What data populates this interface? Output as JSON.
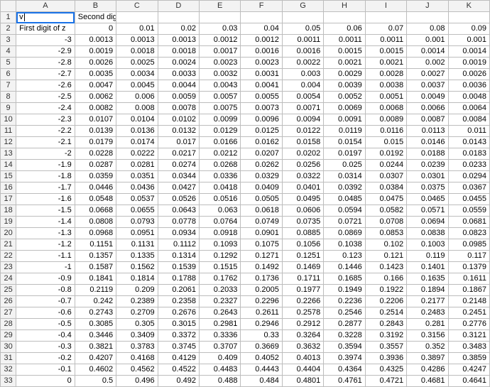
{
  "columns": [
    "A",
    "B",
    "C",
    "D",
    "E",
    "F",
    "G",
    "H",
    "I",
    "J",
    "K"
  ],
  "activeCell": "A1",
  "rows": [
    {
      "r": 1,
      "cells": [
        "v",
        "Second digit of z",
        "",
        "",
        "",
        "",
        "",
        "",
        "",
        "",
        ""
      ],
      "align": [
        "txt",
        "txt",
        "txt",
        "txt",
        "txt",
        "txt",
        "txt",
        "txt",
        "txt",
        "txt",
        "txt"
      ]
    },
    {
      "r": 2,
      "cells": [
        "First digit of z",
        "0",
        "0.01",
        "0.02",
        "0.03",
        "0.04",
        "0.05",
        "0.06",
        "0.07",
        "0.08",
        "0.09"
      ],
      "align": [
        "txt",
        "num",
        "num",
        "num",
        "num",
        "num",
        "num",
        "num",
        "num",
        "num",
        "num"
      ]
    },
    {
      "r": 3,
      "cells": [
        "-3",
        "0.0013",
        "0.0013",
        "0.0013",
        "0.0012",
        "0.0012",
        "0.0011",
        "0.0011",
        "0.0011",
        "0.001",
        "0.001"
      ],
      "align": [
        "num",
        "num",
        "num",
        "num",
        "num",
        "num",
        "num",
        "num",
        "num",
        "num",
        "num"
      ]
    },
    {
      "r": 4,
      "cells": [
        "-2.9",
        "0.0019",
        "0.0018",
        "0.0018",
        "0.0017",
        "0.0016",
        "0.0016",
        "0.0015",
        "0.0015",
        "0.0014",
        "0.0014"
      ],
      "align": [
        "num",
        "num",
        "num",
        "num",
        "num",
        "num",
        "num",
        "num",
        "num",
        "num",
        "num"
      ]
    },
    {
      "r": 5,
      "cells": [
        "-2.8",
        "0.0026",
        "0.0025",
        "0.0024",
        "0.0023",
        "0.0023",
        "0.0022",
        "0.0021",
        "0.0021",
        "0.002",
        "0.0019"
      ],
      "align": [
        "num",
        "num",
        "num",
        "num",
        "num",
        "num",
        "num",
        "num",
        "num",
        "num",
        "num"
      ]
    },
    {
      "r": 6,
      "cells": [
        "-2.7",
        "0.0035",
        "0.0034",
        "0.0033",
        "0.0032",
        "0.0031",
        "0.003",
        "0.0029",
        "0.0028",
        "0.0027",
        "0.0026"
      ],
      "align": [
        "num",
        "num",
        "num",
        "num",
        "num",
        "num",
        "num",
        "num",
        "num",
        "num",
        "num"
      ]
    },
    {
      "r": 7,
      "cells": [
        "-2.6",
        "0.0047",
        "0.0045",
        "0.0044",
        "0.0043",
        "0.0041",
        "0.004",
        "0.0039",
        "0.0038",
        "0.0037",
        "0.0036"
      ],
      "align": [
        "num",
        "num",
        "num",
        "num",
        "num",
        "num",
        "num",
        "num",
        "num",
        "num",
        "num"
      ]
    },
    {
      "r": 8,
      "cells": [
        "-2.5",
        "0.0062",
        "0.006",
        "0.0059",
        "0.0057",
        "0.0055",
        "0.0054",
        "0.0052",
        "0.0051",
        "0.0049",
        "0.0048"
      ],
      "align": [
        "num",
        "num",
        "num",
        "num",
        "num",
        "num",
        "num",
        "num",
        "num",
        "num",
        "num"
      ]
    },
    {
      "r": 9,
      "cells": [
        "-2.4",
        "0.0082",
        "0.008",
        "0.0078",
        "0.0075",
        "0.0073",
        "0.0071",
        "0.0069",
        "0.0068",
        "0.0066",
        "0.0064"
      ],
      "align": [
        "num",
        "num",
        "num",
        "num",
        "num",
        "num",
        "num",
        "num",
        "num",
        "num",
        "num"
      ]
    },
    {
      "r": 10,
      "cells": [
        "-2.3",
        "0.0107",
        "0.0104",
        "0.0102",
        "0.0099",
        "0.0096",
        "0.0094",
        "0.0091",
        "0.0089",
        "0.0087",
        "0.0084"
      ],
      "align": [
        "num",
        "num",
        "num",
        "num",
        "num",
        "num",
        "num",
        "num",
        "num",
        "num",
        "num"
      ]
    },
    {
      "r": 11,
      "cells": [
        "-2.2",
        "0.0139",
        "0.0136",
        "0.0132",
        "0.0129",
        "0.0125",
        "0.0122",
        "0.0119",
        "0.0116",
        "0.0113",
        "0.011"
      ],
      "align": [
        "num",
        "num",
        "num",
        "num",
        "num",
        "num",
        "num",
        "num",
        "num",
        "num",
        "num"
      ]
    },
    {
      "r": 12,
      "cells": [
        "-2.1",
        "0.0179",
        "0.0174",
        "0.017",
        "0.0166",
        "0.0162",
        "0.0158",
        "0.0154",
        "0.015",
        "0.0146",
        "0.0143"
      ],
      "align": [
        "num",
        "num",
        "num",
        "num",
        "num",
        "num",
        "num",
        "num",
        "num",
        "num",
        "num"
      ]
    },
    {
      "r": 13,
      "cells": [
        "-2",
        "0.0228",
        "0.0222",
        "0.0217",
        "0.0212",
        "0.0207",
        "0.0202",
        "0.0197",
        "0.0192",
        "0.0188",
        "0.0183"
      ],
      "align": [
        "num",
        "num",
        "num",
        "num",
        "num",
        "num",
        "num",
        "num",
        "num",
        "num",
        "num"
      ]
    },
    {
      "r": 14,
      "cells": [
        "-1.9",
        "0.0287",
        "0.0281",
        "0.0274",
        "0.0268",
        "0.0262",
        "0.0256",
        "0.025",
        "0.0244",
        "0.0239",
        "0.0233"
      ],
      "align": [
        "num",
        "num",
        "num",
        "num",
        "num",
        "num",
        "num",
        "num",
        "num",
        "num",
        "num"
      ]
    },
    {
      "r": 15,
      "cells": [
        "-1.8",
        "0.0359",
        "0.0351",
        "0.0344",
        "0.0336",
        "0.0329",
        "0.0322",
        "0.0314",
        "0.0307",
        "0.0301",
        "0.0294"
      ],
      "align": [
        "num",
        "num",
        "num",
        "num",
        "num",
        "num",
        "num",
        "num",
        "num",
        "num",
        "num"
      ]
    },
    {
      "r": 16,
      "cells": [
        "-1.7",
        "0.0446",
        "0.0436",
        "0.0427",
        "0.0418",
        "0.0409",
        "0.0401",
        "0.0392",
        "0.0384",
        "0.0375",
        "0.0367"
      ],
      "align": [
        "num",
        "num",
        "num",
        "num",
        "num",
        "num",
        "num",
        "num",
        "num",
        "num",
        "num"
      ]
    },
    {
      "r": 17,
      "cells": [
        "-1.6",
        "0.0548",
        "0.0537",
        "0.0526",
        "0.0516",
        "0.0505",
        "0.0495",
        "0.0485",
        "0.0475",
        "0.0465",
        "0.0455"
      ],
      "align": [
        "num",
        "num",
        "num",
        "num",
        "num",
        "num",
        "num",
        "num",
        "num",
        "num",
        "num"
      ]
    },
    {
      "r": 18,
      "cells": [
        "-1.5",
        "0.0668",
        "0.0655",
        "0.0643",
        "0.063",
        "0.0618",
        "0.0606",
        "0.0594",
        "0.0582",
        "0.0571",
        "0.0559"
      ],
      "align": [
        "num",
        "num",
        "num",
        "num",
        "num",
        "num",
        "num",
        "num",
        "num",
        "num",
        "num"
      ]
    },
    {
      "r": 19,
      "cells": [
        "-1.4",
        "0.0808",
        "0.0793",
        "0.0778",
        "0.0764",
        "0.0749",
        "0.0735",
        "0.0721",
        "0.0708",
        "0.0694",
        "0.0681"
      ],
      "align": [
        "num",
        "num",
        "num",
        "num",
        "num",
        "num",
        "num",
        "num",
        "num",
        "num",
        "num"
      ]
    },
    {
      "r": 20,
      "cells": [
        "-1.3",
        "0.0968",
        "0.0951",
        "0.0934",
        "0.0918",
        "0.0901",
        "0.0885",
        "0.0869",
        "0.0853",
        "0.0838",
        "0.0823"
      ],
      "align": [
        "num",
        "num",
        "num",
        "num",
        "num",
        "num",
        "num",
        "num",
        "num",
        "num",
        "num"
      ]
    },
    {
      "r": 21,
      "cells": [
        "-1.2",
        "0.1151",
        "0.1131",
        "0.1112",
        "0.1093",
        "0.1075",
        "0.1056",
        "0.1038",
        "0.102",
        "0.1003",
        "0.0985"
      ],
      "align": [
        "num",
        "num",
        "num",
        "num",
        "num",
        "num",
        "num",
        "num",
        "num",
        "num",
        "num"
      ]
    },
    {
      "r": 22,
      "cells": [
        "-1.1",
        "0.1357",
        "0.1335",
        "0.1314",
        "0.1292",
        "0.1271",
        "0.1251",
        "0.123",
        "0.121",
        "0.119",
        "0.117"
      ],
      "align": [
        "num",
        "num",
        "num",
        "num",
        "num",
        "num",
        "num",
        "num",
        "num",
        "num",
        "num"
      ]
    },
    {
      "r": 23,
      "cells": [
        "-1",
        "0.1587",
        "0.1562",
        "0.1539",
        "0.1515",
        "0.1492",
        "0.1469",
        "0.1446",
        "0.1423",
        "0.1401",
        "0.1379"
      ],
      "align": [
        "num",
        "num",
        "num",
        "num",
        "num",
        "num",
        "num",
        "num",
        "num",
        "num",
        "num"
      ]
    },
    {
      "r": 24,
      "cells": [
        "-0.9",
        "0.1841",
        "0.1814",
        "0.1788",
        "0.1762",
        "0.1736",
        "0.1711",
        "0.1685",
        "0.166",
        "0.1635",
        "0.1611"
      ],
      "align": [
        "num",
        "num",
        "num",
        "num",
        "num",
        "num",
        "num",
        "num",
        "num",
        "num",
        "num"
      ]
    },
    {
      "r": 25,
      "cells": [
        "-0.8",
        "0.2119",
        "0.209",
        "0.2061",
        "0.2033",
        "0.2005",
        "0.1977",
        "0.1949",
        "0.1922",
        "0.1894",
        "0.1867"
      ],
      "align": [
        "num",
        "num",
        "num",
        "num",
        "num",
        "num",
        "num",
        "num",
        "num",
        "num",
        "num"
      ]
    },
    {
      "r": 26,
      "cells": [
        "-0.7",
        "0.242",
        "0.2389",
        "0.2358",
        "0.2327",
        "0.2296",
        "0.2266",
        "0.2236",
        "0.2206",
        "0.2177",
        "0.2148"
      ],
      "align": [
        "num",
        "num",
        "num",
        "num",
        "num",
        "num",
        "num",
        "num",
        "num",
        "num",
        "num"
      ]
    },
    {
      "r": 27,
      "cells": [
        "-0.6",
        "0.2743",
        "0.2709",
        "0.2676",
        "0.2643",
        "0.2611",
        "0.2578",
        "0.2546",
        "0.2514",
        "0.2483",
        "0.2451"
      ],
      "align": [
        "num",
        "num",
        "num",
        "num",
        "num",
        "num",
        "num",
        "num",
        "num",
        "num",
        "num"
      ]
    },
    {
      "r": 28,
      "cells": [
        "-0.5",
        "0.3085",
        "0.305",
        "0.3015",
        "0.2981",
        "0.2946",
        "0.2912",
        "0.2877",
        "0.2843",
        "0.281",
        "0.2776"
      ],
      "align": [
        "num",
        "num",
        "num",
        "num",
        "num",
        "num",
        "num",
        "num",
        "num",
        "num",
        "num"
      ]
    },
    {
      "r": 29,
      "cells": [
        "-0.4",
        "0.3446",
        "0.3409",
        "0.3372",
        "0.3336",
        "0.33",
        "0.3264",
        "0.3228",
        "0.3192",
        "0.3156",
        "0.3121"
      ],
      "align": [
        "num",
        "num",
        "num",
        "num",
        "num",
        "num",
        "num",
        "num",
        "num",
        "num",
        "num"
      ]
    },
    {
      "r": 30,
      "cells": [
        "-0.3",
        "0.3821",
        "0.3783",
        "0.3745",
        "0.3707",
        "0.3669",
        "0.3632",
        "0.3594",
        "0.3557",
        "0.352",
        "0.3483"
      ],
      "align": [
        "num",
        "num",
        "num",
        "num",
        "num",
        "num",
        "num",
        "num",
        "num",
        "num",
        "num"
      ]
    },
    {
      "r": 31,
      "cells": [
        "-0.2",
        "0.4207",
        "0.4168",
        "0.4129",
        "0.409",
        "0.4052",
        "0.4013",
        "0.3974",
        "0.3936",
        "0.3897",
        "0.3859"
      ],
      "align": [
        "num",
        "num",
        "num",
        "num",
        "num",
        "num",
        "num",
        "num",
        "num",
        "num",
        "num"
      ]
    },
    {
      "r": 32,
      "cells": [
        "-0.1",
        "0.4602",
        "0.4562",
        "0.4522",
        "0.4483",
        "0.4443",
        "0.4404",
        "0.4364",
        "0.4325",
        "0.4286",
        "0.4247"
      ],
      "align": [
        "num",
        "num",
        "num",
        "num",
        "num",
        "num",
        "num",
        "num",
        "num",
        "num",
        "num"
      ]
    },
    {
      "r": 33,
      "cells": [
        "0",
        "0.5",
        "0.496",
        "0.492",
        "0.488",
        "0.484",
        "0.4801",
        "0.4761",
        "0.4721",
        "0.4681",
        "0.4641"
      ],
      "align": [
        "num",
        "num",
        "num",
        "num",
        "num",
        "num",
        "num",
        "num",
        "num",
        "num",
        "num"
      ]
    }
  ]
}
